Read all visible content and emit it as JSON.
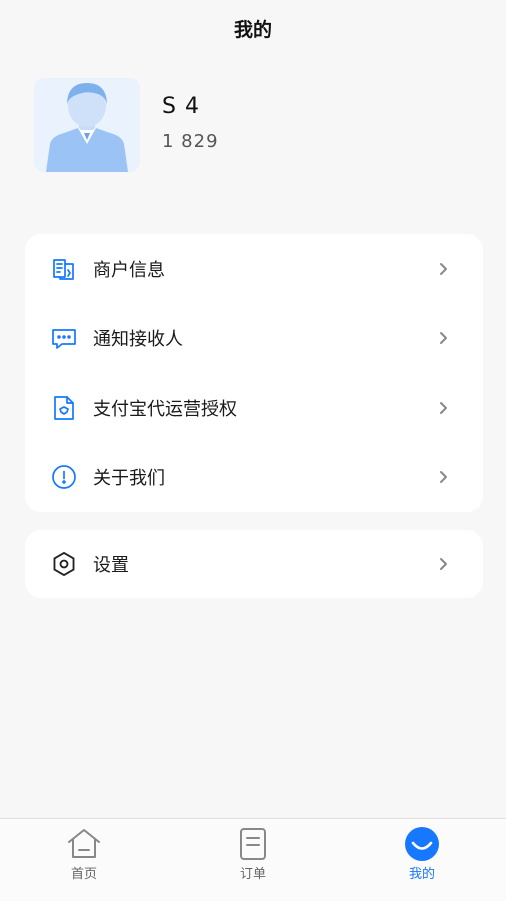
{
  "header": {
    "title": "我的"
  },
  "profile": {
    "name": "S         4",
    "phone": "1            829"
  },
  "menu": {
    "items": [
      {
        "label": "商户信息",
        "icon": "merchant-info-icon"
      },
      {
        "label": "通知接收人",
        "icon": "message-icon"
      },
      {
        "label": "支付宝代运营授权",
        "icon": "authorization-document-icon"
      },
      {
        "label": "关于我们",
        "icon": "info-circle-icon"
      }
    ],
    "settings": {
      "label": "设置",
      "icon": "gear-icon"
    }
  },
  "tabbar": {
    "tabs": [
      {
        "label": "首页",
        "icon": "home-icon",
        "active": false
      },
      {
        "label": "订单",
        "icon": "order-icon",
        "active": false
      },
      {
        "label": "我的",
        "icon": "profile-smile-icon",
        "active": true
      }
    ]
  },
  "colors": {
    "accent": "#1677ff",
    "background": "#f7f7f8",
    "card": "#ffffff"
  }
}
